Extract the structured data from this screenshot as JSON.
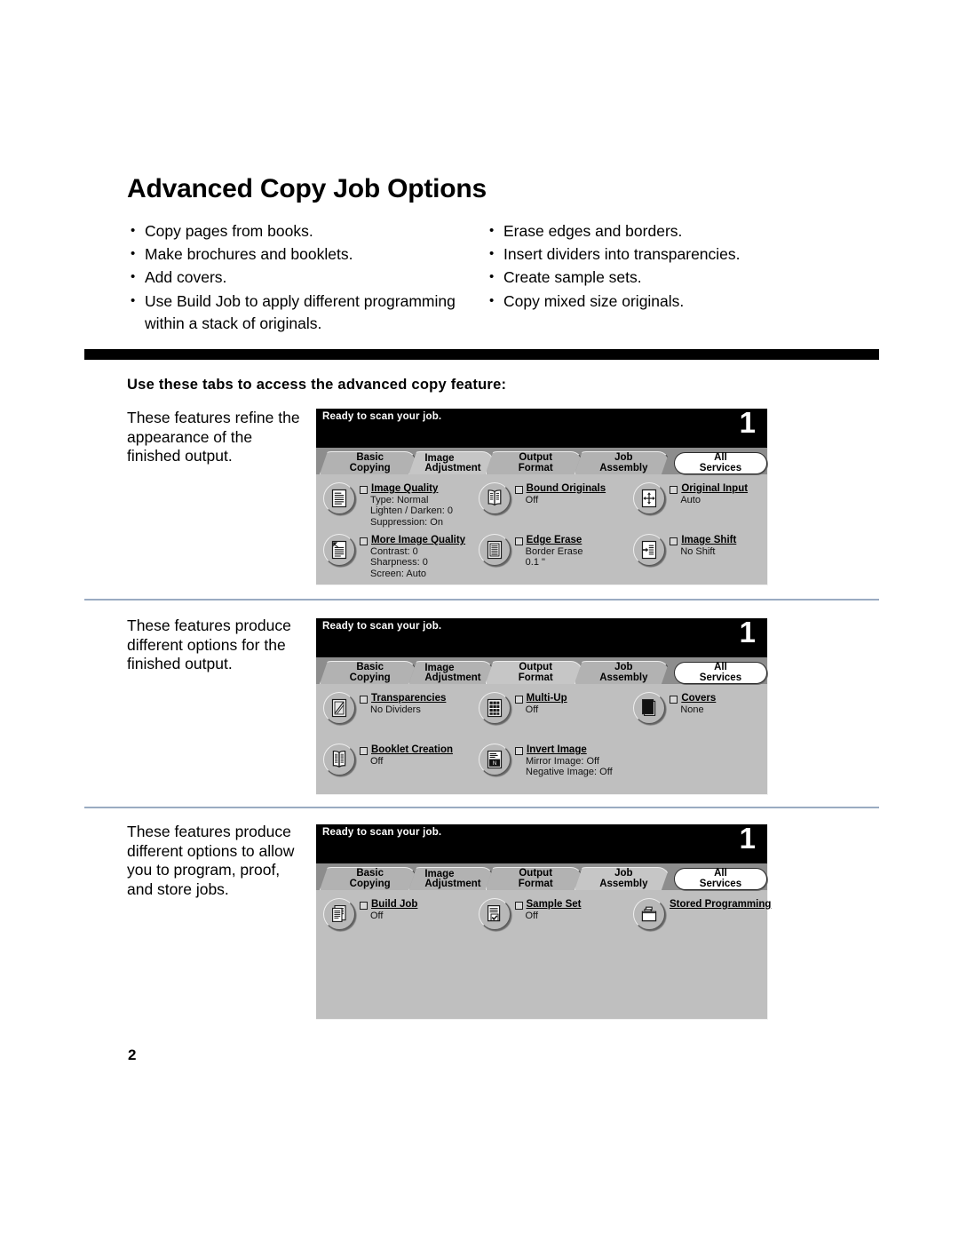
{
  "document": {
    "title": "Advanced Copy Job Options",
    "page_number": "2",
    "section_heading": "Use these tabs to access the advanced copy feature:"
  },
  "bullets": {
    "left": [
      "Copy pages from books.",
      "Make brochures and booklets.",
      "Add covers.",
      "Use Build Job to apply different programming within a stack of originals."
    ],
    "right": [
      "Erase edges and borders.",
      "Insert dividers into transparencies.",
      "Create sample sets.",
      "Copy mixed size originals."
    ]
  },
  "panels": [
    {
      "caption": "These features refine the appearance of the finished output.",
      "status_text": "Ready to scan your job.",
      "status_count": "1",
      "tabs": [
        {
          "label": "Basic Copying",
          "label2": "",
          "active": false
        },
        {
          "label": "Image",
          "label2": "Adjustment",
          "active": true
        },
        {
          "label": "Output Format",
          "label2": "",
          "active": false
        },
        {
          "label": "Job Assembly",
          "label2": "",
          "active": false
        }
      ],
      "all_services_label": "All Services",
      "features": [
        {
          "name": "Image Quality",
          "icon": "document-icon",
          "checkbox": true,
          "status": [
            "Type: Normal",
            "Lighten / Darken: 0",
            "Suppression: On"
          ]
        },
        {
          "name": "Bound Originals",
          "icon": "open-book-icon",
          "checkbox": true,
          "status": [
            "Off"
          ]
        },
        {
          "name": "Original Input",
          "icon": "original-size-icon",
          "checkbox": true,
          "status": [
            "Auto"
          ]
        },
        {
          "name": "More Image Quality",
          "icon": "document-contrast-icon",
          "checkbox": true,
          "status": [
            "Contrast: 0",
            "Sharpness: 0",
            "Screen: Auto"
          ]
        },
        {
          "name": "Edge Erase",
          "icon": "edge-erase-icon",
          "checkbox": true,
          "status": [
            "Border Erase",
            "0.1 \""
          ]
        },
        {
          "name": "Image Shift",
          "icon": "image-shift-icon",
          "checkbox": true,
          "status": [
            "No Shift"
          ]
        }
      ]
    },
    {
      "caption": "These features produce different options for the finished output.",
      "status_text": "Ready to scan your job.",
      "status_count": "1",
      "tabs": [
        {
          "label": "Basic Copying",
          "label2": "",
          "active": false
        },
        {
          "label": "Image",
          "label2": "Adjustment",
          "active": false
        },
        {
          "label": "Output Format",
          "label2": "",
          "active": true
        },
        {
          "label": "Job Assembly",
          "label2": "",
          "active": false
        }
      ],
      "all_services_label": "All Services",
      "features": [
        {
          "name": "Transparencies",
          "icon": "transparency-icon",
          "checkbox": true,
          "status": [
            "No Dividers"
          ]
        },
        {
          "name": "Multi-Up",
          "icon": "multi-up-icon",
          "checkbox": true,
          "status": [
            "Off"
          ]
        },
        {
          "name": "Covers",
          "icon": "covers-icon",
          "checkbox": true,
          "status": [
            "None"
          ]
        },
        {
          "name": "Booklet Creation",
          "icon": "booklet-icon",
          "checkbox": true,
          "status": [
            "Off"
          ]
        },
        {
          "name": "Invert Image",
          "icon": "invert-image-icon",
          "checkbox": true,
          "status": [
            "Mirror Image: Off",
            "Negative Image: Off"
          ]
        }
      ]
    },
    {
      "caption": "These features produce different options to allow you to program, proof, and store jobs.",
      "status_text": "Ready to scan your job.",
      "status_count": "1",
      "tabs": [
        {
          "label": "Basic Copying",
          "label2": "",
          "active": false
        },
        {
          "label": "Image",
          "label2": "Adjustment",
          "active": false
        },
        {
          "label": "Output Format",
          "label2": "",
          "active": false
        },
        {
          "label": "Job Assembly",
          "label2": "",
          "active": true
        }
      ],
      "all_services_label": "All Services",
      "features": [
        {
          "name": "Build Job",
          "icon": "build-job-icon",
          "checkbox": true,
          "status": [
            "Off"
          ]
        },
        {
          "name": "Sample Set",
          "icon": "sample-set-icon",
          "checkbox": true,
          "status": [
            "Off"
          ]
        },
        {
          "name": "Stored Programming",
          "icon": "stored-programming-icon",
          "checkbox": false,
          "status": []
        }
      ]
    }
  ]
}
